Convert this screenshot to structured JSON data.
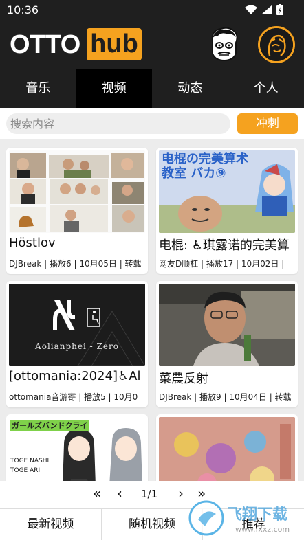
{
  "status": {
    "time": "10:36"
  },
  "header": {
    "logo_left": "OTTO",
    "logo_right": "hub"
  },
  "tabs": [
    {
      "label": "音乐",
      "active": false
    },
    {
      "label": "视频",
      "active": true
    },
    {
      "label": "动态",
      "active": false
    },
    {
      "label": "个人",
      "active": false
    }
  ],
  "search": {
    "placeholder": "搜索内容",
    "button": "冲刺"
  },
  "videos": [
    {
      "title": "Höstlov",
      "meta": "DJBreak | 播放6 | 10月05日 | 转载"
    },
    {
      "title": "电棍: ♿琪露诺的完美算",
      "meta": "网友D顺杠 | 播放17 | 10月02日 |",
      "thumb_text": "电棍の完美算术教室 バカ⑨"
    },
    {
      "title": "[ottomania:2024]♿Al",
      "meta": "ottomania音游寄 | 播放5 | 10月0",
      "thumb_text": "Aolianphei - Zero"
    },
    {
      "title": "菜農反射",
      "meta": "DJBreak | 播放9 | 10月04日 | 转载"
    },
    {
      "title": "",
      "meta": "",
      "thumb_text": "ガールズバンドクライ"
    },
    {
      "title": "",
      "meta": ""
    }
  ],
  "pager": {
    "first": "«",
    "prev": "‹",
    "page": "1/1",
    "next": "›",
    "last": "»"
  },
  "bottom": {
    "latest": "最新视频",
    "random": "随机视频",
    "third": "推荐"
  },
  "colors": {
    "accent": "#f5a21f",
    "dark": "#1f1f1f"
  }
}
